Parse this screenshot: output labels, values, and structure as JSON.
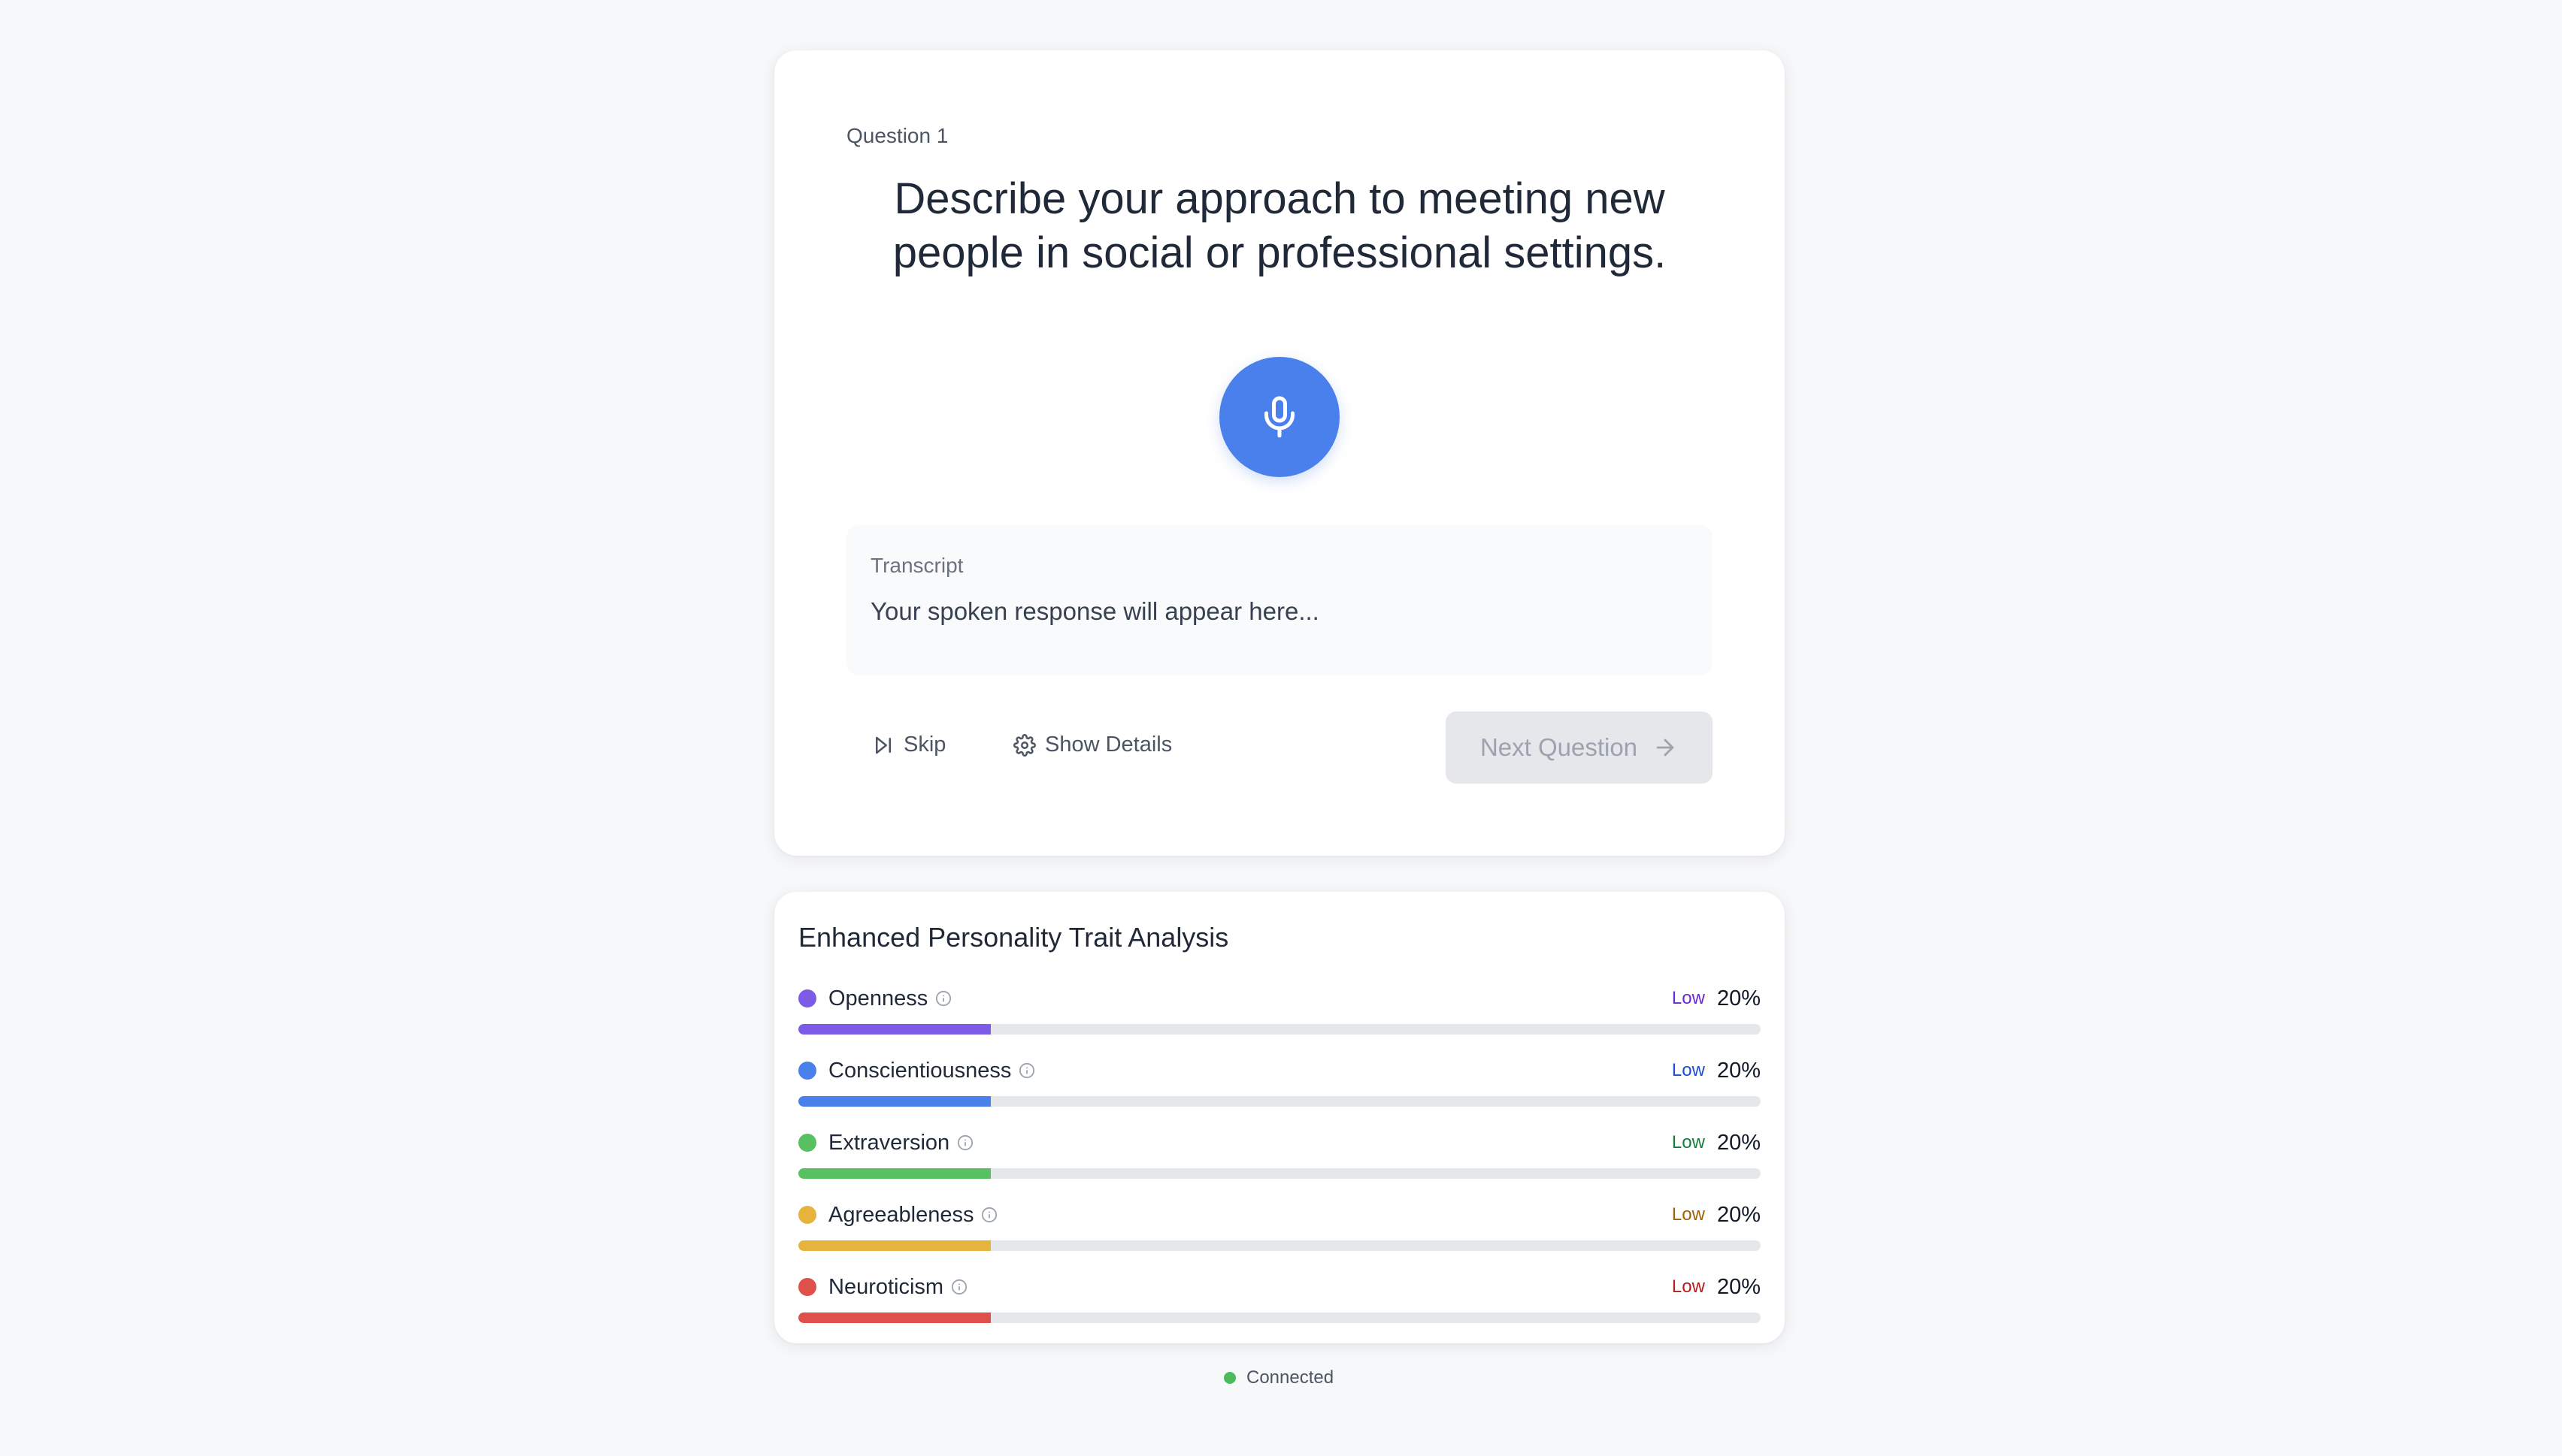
{
  "question": {
    "number_label": "Question 1",
    "text": "Describe your approach to meeting new people in social or professional settings.",
    "mic_icon": "microphone-icon"
  },
  "transcript": {
    "label": "Transcript",
    "text": "Your spoken response will appear here..."
  },
  "actions": {
    "skip_label": "Skip",
    "skip_icon": "skip-forward-icon",
    "details_label": "Show Details",
    "details_icon": "gear-icon",
    "next_label": "Next Question",
    "next_icon": "arrow-right-icon"
  },
  "traits_panel": {
    "title": "Enhanced Personality Trait Analysis",
    "traits": [
      {
        "name": "Openness",
        "level": "Low",
        "percent_label": "20%",
        "percent": 20,
        "color": "#7c5ce6",
        "level_color": "#6d28d9"
      },
      {
        "name": "Conscientiousness",
        "level": "Low",
        "percent_label": "20%",
        "percent": 20,
        "color": "#4a80ec",
        "level_color": "#1d4ed8"
      },
      {
        "name": "Extraversion",
        "level": "Low",
        "percent_label": "20%",
        "percent": 20,
        "color": "#57c060",
        "level_color": "#15803d"
      },
      {
        "name": "Agreeableness",
        "level": "Low",
        "percent_label": "20%",
        "percent": 20,
        "color": "#e6b43c",
        "level_color": "#a16207"
      },
      {
        "name": "Neuroticism",
        "level": "Low",
        "percent_label": "20%",
        "percent": 20,
        "color": "#e0504a",
        "level_color": "#b91c1c"
      }
    ]
  },
  "status": {
    "label": "Connected",
    "color": "#4cbb5e"
  }
}
